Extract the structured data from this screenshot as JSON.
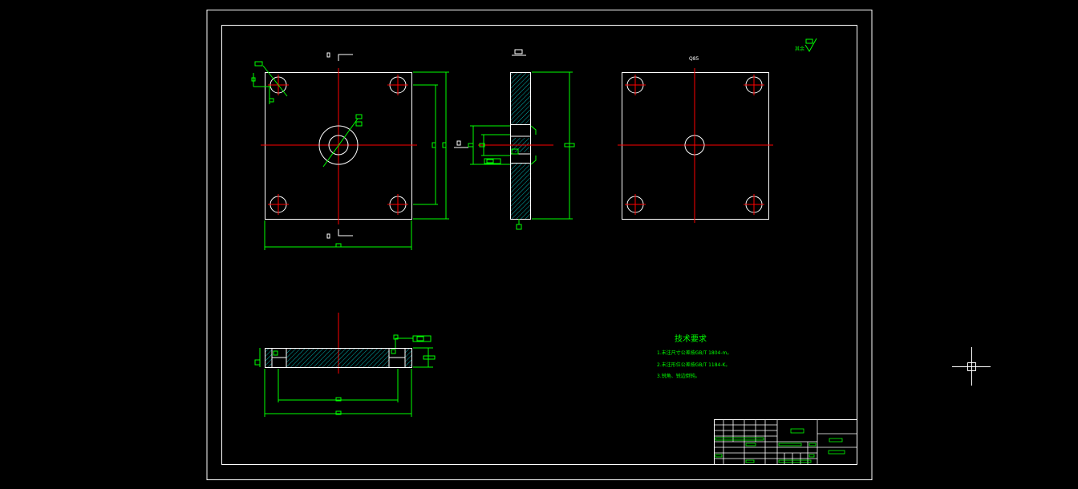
{
  "drawing": {
    "colors": {
      "background": "#000000",
      "outline": "#ffffff",
      "dimension": "#00ff00",
      "centerline": "#ff0000",
      "hatch": "#00ffff",
      "text": "#00ff00"
    },
    "top_view_label": "Q85",
    "technical_requirements": {
      "title": "技术要求",
      "items": [
        "1.未注尺寸公差按GB/T 1804-m。",
        "2.未注形位公差按GB/T 1184-K。",
        "3.锐角、锐边倒钝。"
      ]
    },
    "roughness_note": "其余"
  },
  "cursor": {
    "icon": "crosshair-icon"
  }
}
